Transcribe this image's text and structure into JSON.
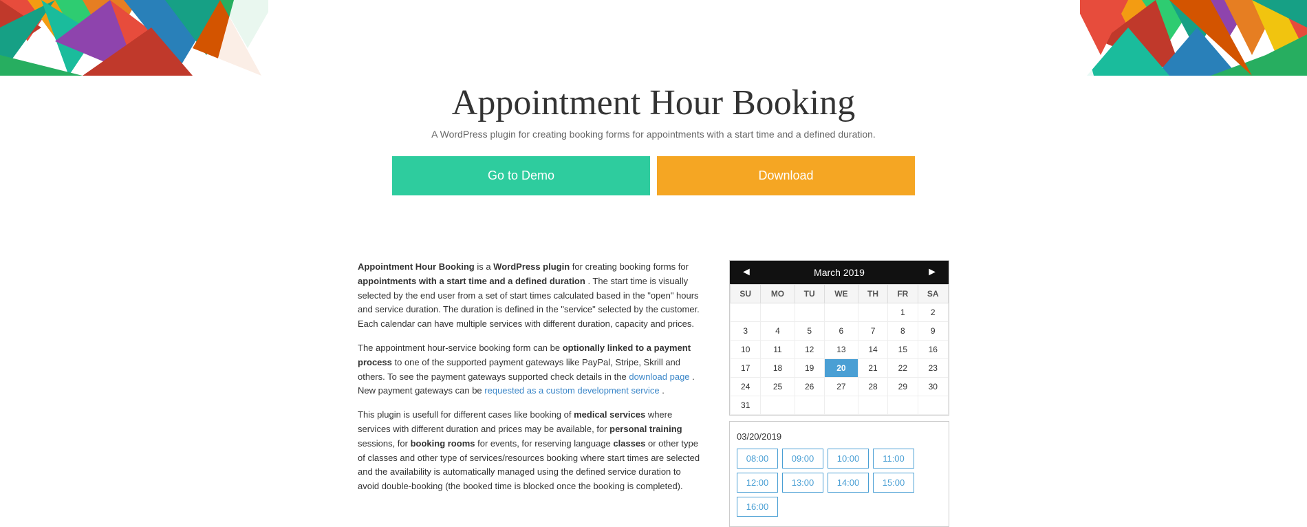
{
  "header": {
    "title": "Appointment Hour Booking",
    "subtitle": "A WordPress plugin for creating booking forms for appointments with a start time and a defined duration."
  },
  "buttons": {
    "demo_label": "Go to Demo",
    "download_label": "Download"
  },
  "colors": {
    "demo_bg": "#2ecc9e",
    "download_bg": "#f5a623",
    "calendar_header_bg": "#111111",
    "today_bg": "#4a9fd4"
  },
  "description": {
    "paragraph1_pre": "Appointment Hour Booking",
    "paragraph1_bold": " is a ",
    "paragraph1_bold2": "WordPress plugin",
    "paragraph1_rest": " for creating booking forms for ",
    "paragraph1_bold3": "appointments with a start time and a defined duration",
    "paragraph1_cont": ". The start time is visually selected by the end user from a set of start times calculated based in the \"open\" hours and service duration. The duration is defined in the \"service\" selected by the customer. Each calendar can have multiple services with different duration, capacity and prices.",
    "paragraph2_pre": "The appointment hour-service booking form can be ",
    "paragraph2_bold": "optionally linked to a payment process",
    "paragraph2_rest": " to one of the supported payment gateways like PayPal, Stripe, Skrill and others. To see the payment gateways supported check details in the ",
    "paragraph2_link1": "download page",
    "paragraph2_rest2": ". New payment gateways can be ",
    "paragraph2_link2": "requested as a custom development service",
    "paragraph2_end": ".",
    "paragraph3_pre": "This plugin is usefull for different cases like booking of ",
    "paragraph3_bold": "medical services",
    "paragraph3_rest": " where services with different duration and prices may be available, for ",
    "paragraph3_bold2": "personal training",
    "paragraph3_rest2": " sessions, for ",
    "paragraph3_bold3": "booking rooms",
    "paragraph3_rest3": " for events, for reserving language ",
    "paragraph3_bold4": "classes",
    "paragraph3_rest4": " or other type of classes and other type of services/resources booking where start times are selected and the availability is automatically managed using the defined service duration to avoid double-booking (the booked time is blocked once the booking is completed)."
  },
  "calendar": {
    "title": "March 2019",
    "prev_label": "◄",
    "next_label": "►",
    "day_headers": [
      "SU",
      "MO",
      "TU",
      "WE",
      "TH",
      "FR",
      "SA"
    ],
    "weeks": [
      [
        "",
        "",
        "",
        "",
        "",
        "1",
        "2"
      ],
      [
        "3",
        "4",
        "5",
        "6",
        "7",
        "8",
        "9"
      ],
      [
        "10",
        "11",
        "12",
        "13",
        "14",
        "15",
        "16"
      ],
      [
        "17",
        "18",
        "19",
        "20",
        "21",
        "22",
        "23"
      ],
      [
        "24",
        "25",
        "26",
        "27",
        "28",
        "29",
        "30"
      ],
      [
        "31",
        "",
        "",
        "",
        "",
        "",
        ""
      ]
    ],
    "today_date": "20"
  },
  "timeslots": {
    "date_label": "03/20/2019",
    "slots": [
      "08:00",
      "09:00",
      "10:00",
      "11:00",
      "12:00",
      "13:00",
      "14:00",
      "15:00",
      "16:00"
    ]
  }
}
